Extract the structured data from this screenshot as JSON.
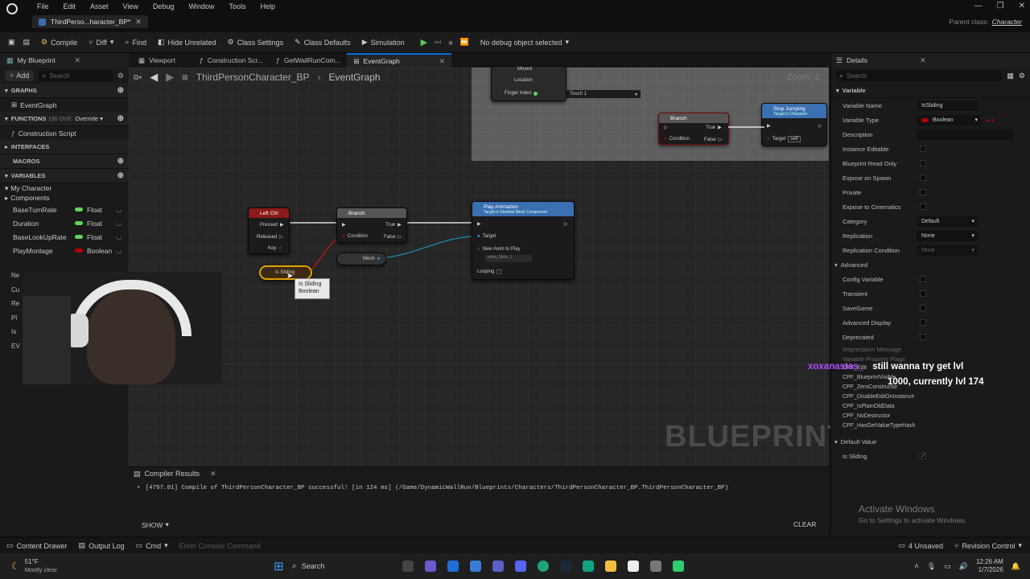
{
  "title_bar": {
    "menu": [
      "File",
      "Edit",
      "Asset",
      "View",
      "Debug",
      "Window",
      "Tools",
      "Help"
    ],
    "doc_tab": "ThirdPerso...haracter_BP*",
    "parent_class_label": "Parent class:",
    "parent_class_value": "Character"
  },
  "toolbar": {
    "compile": "Compile",
    "diff": "Diff",
    "find": "Find",
    "hide_unrelated": "Hide Unrelated",
    "class_settings": "Class Settings",
    "class_defaults": "Class Defaults",
    "simulation": "Simulation",
    "debug_select": "No debug object selected"
  },
  "left_panel": {
    "tab": "My Blueprint",
    "add": "Add",
    "search_placeholder": "Search",
    "graphs_header": "GRAPHS",
    "event_graph": "EventGraph",
    "functions_header": "FUNCTIONS",
    "functions_count": "(36 OVE",
    "override": "Override",
    "construction_script": "Construction Script",
    "interfaces_header": "INTERFACES",
    "macros_header": "MACROS",
    "variables_header": "VARIABLES",
    "my_character": "My Character",
    "components": "Components",
    "variables": [
      {
        "name": "BaseTurnRate",
        "type": "Float",
        "color": "#5fd35f"
      },
      {
        "name": "Duration",
        "type": "Float",
        "color": "#5fd35f"
      },
      {
        "name": "BaseLookUpRate",
        "type": "Float",
        "color": "#5fd35f"
      },
      {
        "name": "PlayMontage",
        "type": "Boolean",
        "color": "#b30000"
      }
    ],
    "partial_rows": [
      "Ne",
      "Cu",
      "Re",
      "Pl",
      "Is",
      "EV"
    ]
  },
  "editor_tabs": [
    {
      "label": "Viewport",
      "active": false
    },
    {
      "label": "Construction Scr...",
      "active": false
    },
    {
      "label": "GetWallRunCom...",
      "active": false
    },
    {
      "label": "EventGraph",
      "active": true
    }
  ],
  "breadcrumb": {
    "blueprint": "ThirdPersonCharacter_BP",
    "graph": "EventGraph"
  },
  "graph": {
    "zoom": "Zoom -2",
    "watermark": "BLUEPRINT",
    "nodes": {
      "leftctrl": {
        "title": "Left Ctrl",
        "pins": [
          "Pressed",
          "Released",
          "Key"
        ]
      },
      "branch1": {
        "title": "Branch",
        "pins": [
          "Condition",
          "True",
          "False"
        ]
      },
      "mesh": {
        "title": "Mesh"
      },
      "play_anim": {
        "title": "Play Animation",
        "subtitle": "Target is Skeletal Mesh Component",
        "pins": [
          "Target",
          "New Anim to Play",
          "Looping"
        ],
        "anim_value": "anim_Slide_1"
      },
      "is_sliding": {
        "title": "Is Sliding"
      },
      "tooltip": {
        "line1": "Is Sliding",
        "line2": "Boolean"
      },
      "top_branch": {
        "title": "Branch",
        "pins": [
          "Condition",
          "True",
          "False"
        ]
      },
      "stop_jumping": {
        "title": "Stop Jumping",
        "subtitle": "Target is Character",
        "target": "Target",
        "target_value": "self"
      },
      "top_left": {
        "pins": [
          "Moved",
          "Location",
          "Finger Index"
        ],
        "touch": "Touch 1"
      }
    }
  },
  "details": {
    "tab": "Details",
    "search_placeholder": "Search",
    "variable_header": "Variable",
    "rows": {
      "variable_name_label": "Variable Name",
      "variable_name": "IsSliding",
      "variable_type_label": "Variable Type",
      "variable_type": "Boolean",
      "description": "Description",
      "instance_editable": "Instance Editable",
      "blueprint_read_only": "Blueprint Read Only",
      "expose_on_spawn": "Expose on Spawn",
      "private": "Private",
      "expose_to_cinematics": "Expose to Cinematics",
      "category_label": "Category",
      "category": "Default",
      "replication_label": "Replication",
      "replication": "None",
      "replication_condition_label": "Replication Condition",
      "replication_condition": "None"
    },
    "advanced_header": "Advanced",
    "advanced_rows": [
      "Config Variable",
      "Transient",
      "SaveGame",
      "Advanced Display",
      "Deprecated"
    ],
    "deprecation_message": "Deprecation Message",
    "flags": [
      "CPF_Edit",
      "CPF_BlueprintVisible",
      "CPF_ZeroConstructor",
      "CPF_DisableEditOnInstance",
      "CPF_IsPlainOldData",
      "CPF_NoDestructor",
      "CPF_HasGetValueTypeHash"
    ],
    "flags_partial": "Variable Property Flags",
    "default_value_header": "Default Value",
    "is_sliding_label": "Is Sliding"
  },
  "chat_overlay": {
    "user": "xoxanastas_",
    "message_line1": "still wanna try get lvl",
    "message_line2": "1000, currently lvl 174"
  },
  "compiler": {
    "tab": "Compiler Results",
    "message": "[4797.01] Compile of ThirdPersonCharacter_BP successful! [in 124 ms] (/Game/DynamicWallRun/Blueprints/Characters/ThirdPersonCharacter_BP.ThirdPersonCharacter_BP)",
    "show": "SHOW",
    "clear": "CLEAR"
  },
  "activation": {
    "title": "Activate Windows",
    "subtitle": "Go to Settings to activate Windows."
  },
  "status_bar": {
    "content_drawer": "Content Drawer",
    "output_log": "Output Log",
    "cmd": "Cmd",
    "console_placeholder": "Enter Console Command",
    "unsaved": "4 Unsaved",
    "revision_control": "Revision Control"
  },
  "taskbar": {
    "temperature": "51°F",
    "weather": "Mostly clear",
    "search": "Search",
    "time": "12:26 AM",
    "date": "1/7/2026"
  }
}
